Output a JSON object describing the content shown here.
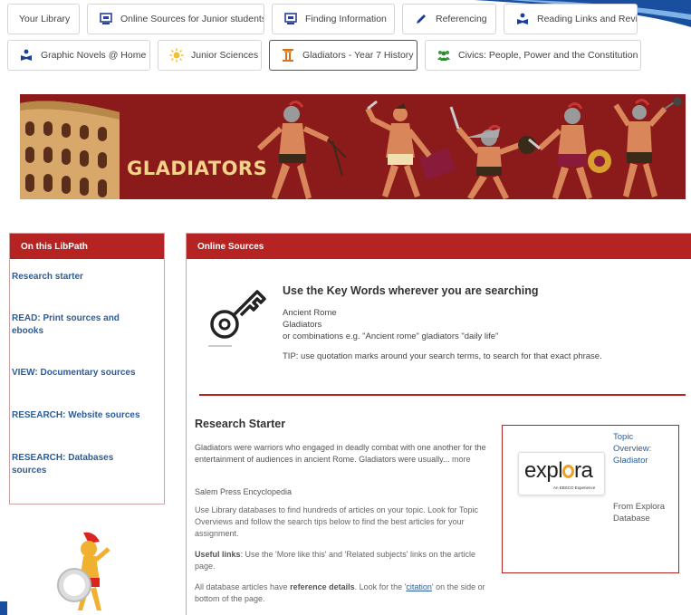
{
  "tabs_row1": [
    {
      "label": "Your Library",
      "icon": "none"
    },
    {
      "label": "Online Sources for Junior students",
      "icon": "screen-icon"
    },
    {
      "label": "Finding Information",
      "icon": "screen-icon"
    },
    {
      "label": "Referencing",
      "icon": "pen-icon"
    },
    {
      "label": "Reading Links and Revi",
      "icon": "reader-icon"
    }
  ],
  "tabs_row2": [
    {
      "label": "Graphic Novels @ Home",
      "icon": "reader-icon"
    },
    {
      "label": "Junior Sciences",
      "icon": "sun-icon"
    },
    {
      "label": "Gladiators - Year 7 History",
      "icon": "column-icon",
      "active": true
    },
    {
      "label": "Civics: People, Power and the Constitution",
      "icon": "people-icon"
    }
  ],
  "banner": {
    "title": "GLADIATORS"
  },
  "left_panel": {
    "heading": "On this LibPath",
    "links": [
      "Research starter",
      "READ: Print sources and ebooks",
      "VIEW: Documentary sources",
      "RESEARCH: Website sources",
      "RESEARCH: Databases sources"
    ]
  },
  "main_panel": {
    "heading": "Online Sources",
    "keywords": {
      "title": "Use the Key Words wherever you are searching",
      "lines": [
        "Ancient Rome",
        "Gladiators",
        "or combinations e.g. \"Ancient rome\" gladiators \"daily life\""
      ],
      "tip": "TIP: use quotation marks around your search terms, to search for that exact phrase."
    },
    "research_starter": {
      "title": "Research Starter",
      "summary": "Gladiators were warriors who engaged in deadly combat with one another for the entertainment of audiences in ancient Rome. Gladiators were usually...",
      "more": "more",
      "source": "Salem Press Encyclopedia",
      "p1": "Use Library databases to find hundreds of articles on your topic. Look for Topic Overviews and follow the search tips below to find the best articles for your assignment.",
      "p2_bold": "Useful links",
      "p2": ": Use the 'More like this' and 'Related subjects' links on the article page.",
      "p3_start": "All database articles have ",
      "p3_bold": "reference details",
      "p3_mid": ". Look for the '",
      "p3_link": "citation",
      "p3_end": "' on the side or bottom of the page."
    },
    "explora": {
      "logo_word_1": "expl",
      "logo_word_2": "ra",
      "logo_sub": "An EBSCO Experience",
      "topic_link": "Topic Overview: Gladiator",
      "from_text": "From Explora Database"
    }
  },
  "colors": {
    "brand_red": "#b52323",
    "banner_red": "#8b1a1a",
    "link_blue": "#2a5d9a"
  }
}
